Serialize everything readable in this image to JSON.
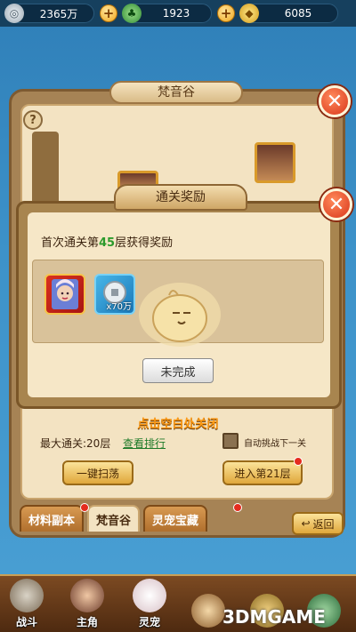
{
  "currency": {
    "silver": "2365万",
    "jade": "1923",
    "gold": "6085"
  },
  "panel": {
    "title": "梵音谷",
    "close": "✕",
    "help": "?"
  },
  "dialog": {
    "title": "通关奖励",
    "close": "✕",
    "desc_prefix": "首次通关第",
    "floor": "45",
    "desc_suffix": "层获得奖励",
    "coin_qty": "x70万",
    "status_button": "未完成"
  },
  "tip": "点击空白处关闭",
  "max_label": "最大通关:20层",
  "rank_link": "查看排行",
  "auto_label": "自动挑战下一关",
  "sweep_button": "一键扫荡",
  "enter_button": "进入第21层",
  "tabs": [
    {
      "label": "材料副本",
      "active": false
    },
    {
      "label": "梵音谷",
      "active": true
    },
    {
      "label": "灵宠宝藏",
      "active": false
    }
  ],
  "back_button": "返回",
  "nav": [
    {
      "label": "战斗"
    },
    {
      "label": "主角"
    },
    {
      "label": "灵宠"
    },
    {
      "label": ""
    },
    {
      "label": ""
    },
    {
      "label": ""
    }
  ],
  "watermark": "3DMGAME",
  "colors": {
    "accent_orange": "#ff9a14",
    "floor_green": "#2b9a2b",
    "close_red": "#d9361a"
  }
}
